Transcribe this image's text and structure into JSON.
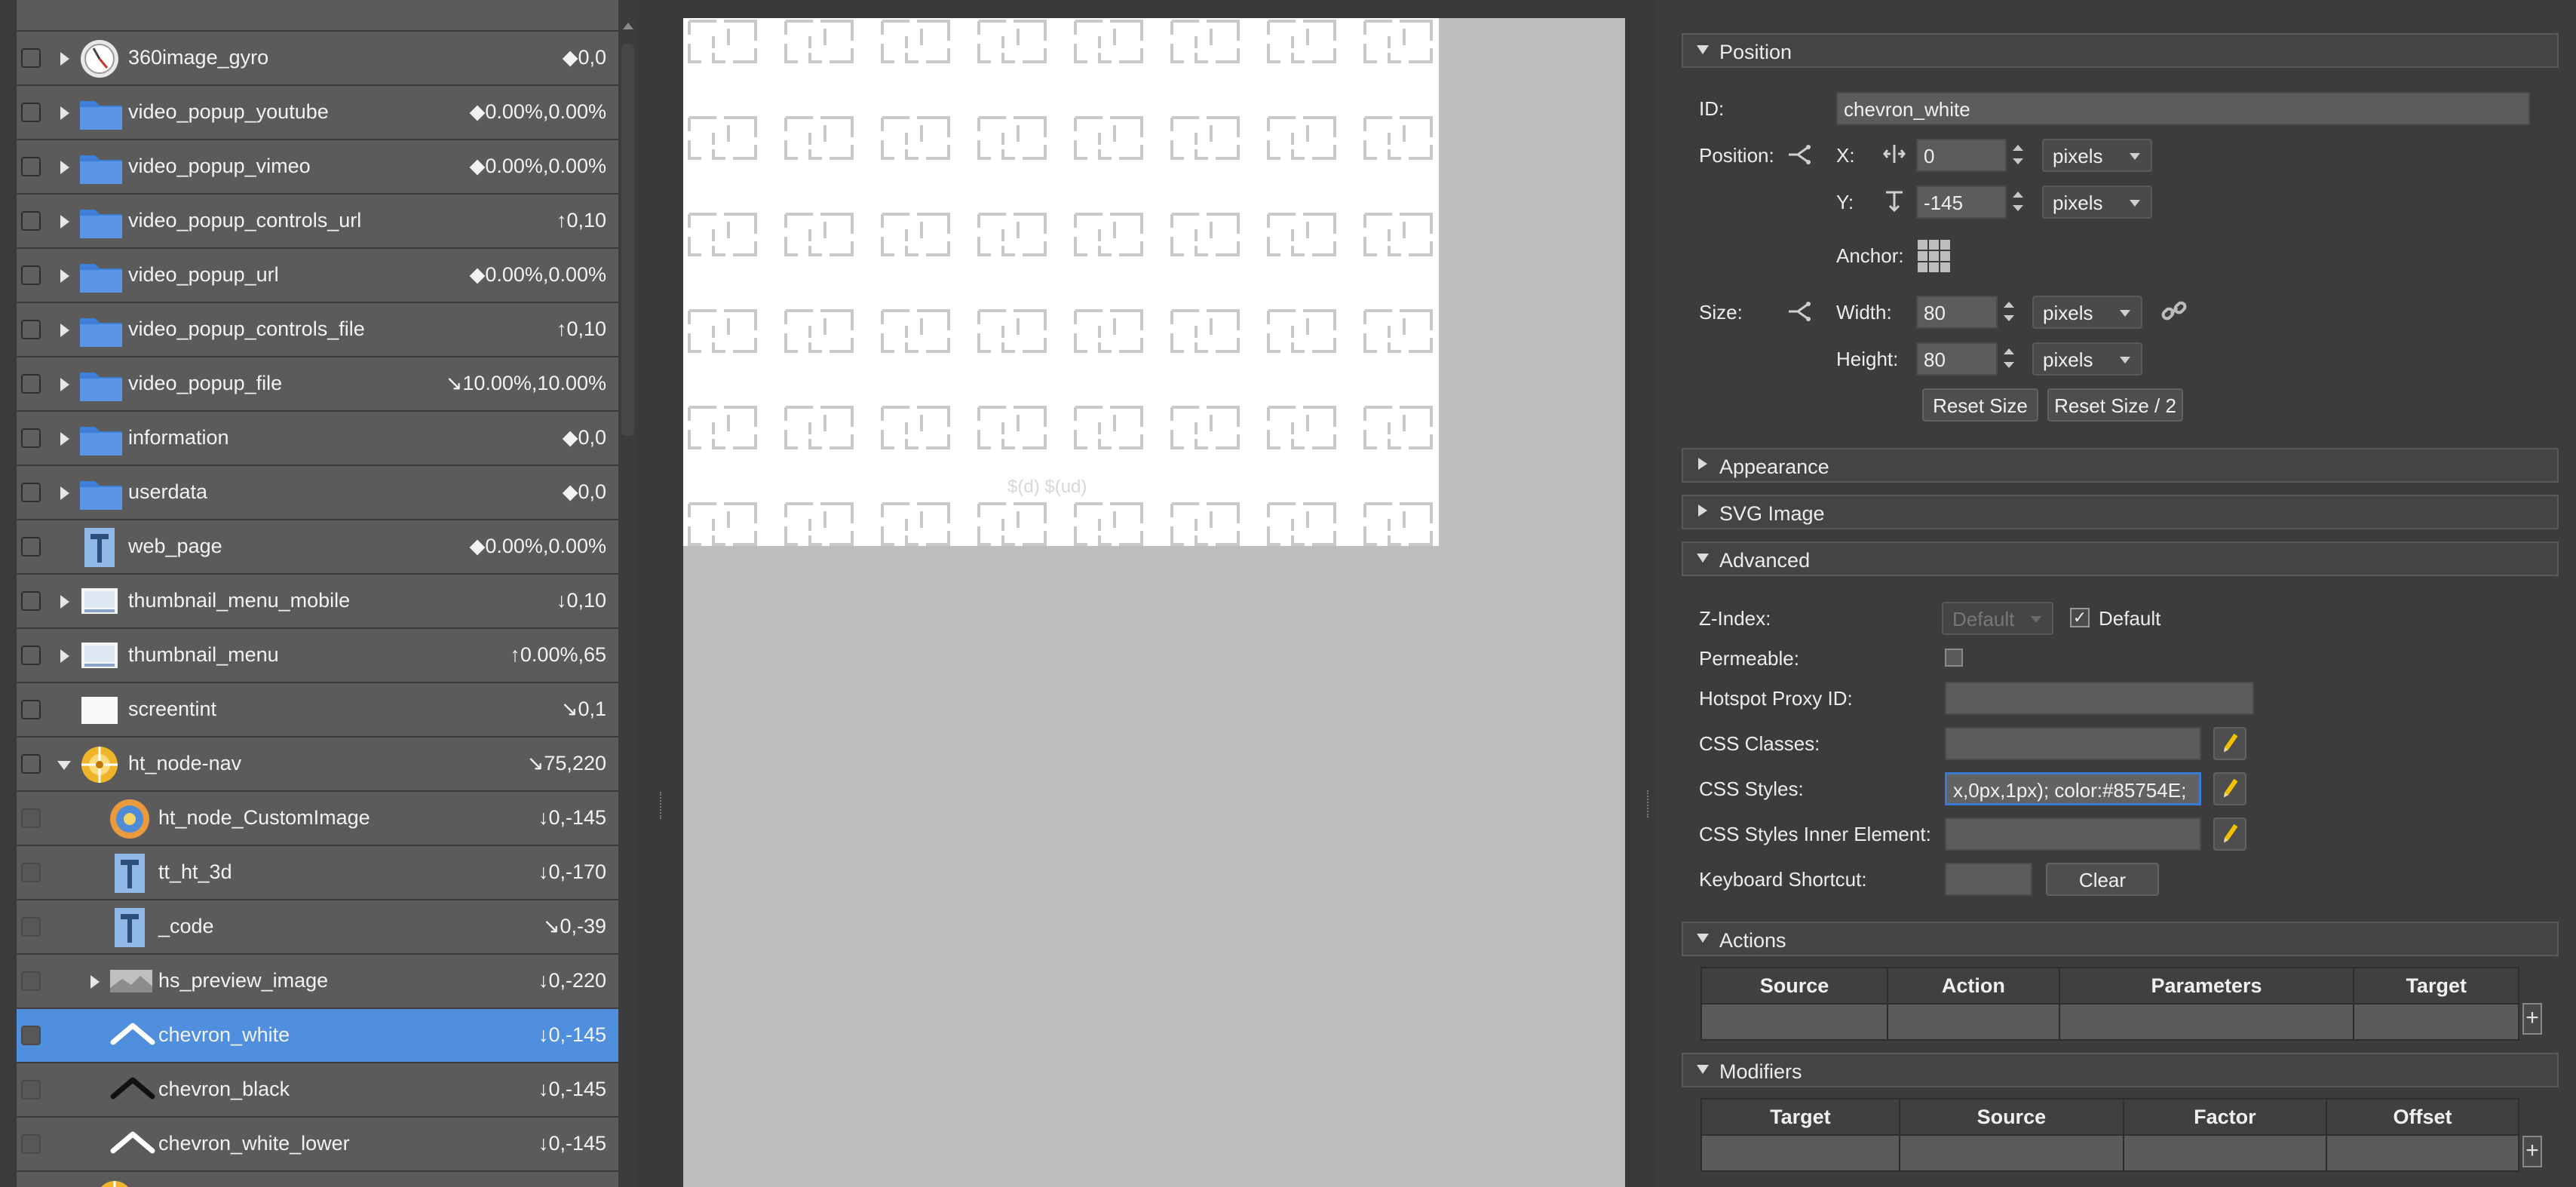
{
  "tree": {
    "rows": [
      {
        "label": "360image_gyro",
        "value": "◆0,0",
        "icon": "gyro-dial-icon",
        "expandable": true
      },
      {
        "label": "video_popup_youtube",
        "value": "◆0.00%,0.00%",
        "icon": "folder-icon",
        "expandable": true
      },
      {
        "label": "video_popup_vimeo",
        "value": "◆0.00%,0.00%",
        "icon": "folder-icon",
        "expandable": true
      },
      {
        "label": "video_popup_controls_url",
        "value": "↑0,10",
        "icon": "folder-icon",
        "expandable": true
      },
      {
        "label": "video_popup_url",
        "value": "◆0.00%,0.00%",
        "icon": "folder-icon",
        "expandable": true
      },
      {
        "label": "video_popup_controls_file",
        "value": "↑0,10",
        "icon": "folder-icon",
        "expandable": true
      },
      {
        "label": "video_popup_file",
        "value": "↘10.00%,10.00%",
        "icon": "folder-icon",
        "expandable": true
      },
      {
        "label": "information",
        "value": "◆0,0",
        "icon": "folder-icon",
        "expandable": true
      },
      {
        "label": "userdata",
        "value": "◆0,0",
        "icon": "folder-icon",
        "expandable": true
      },
      {
        "label": "web_page",
        "value": "◆0.00%,0.00%",
        "icon": "text-element-icon",
        "expandable": false
      },
      {
        "label": "thumbnail_menu_mobile",
        "value": "↓0,10",
        "icon": "thumbnail-icon",
        "expandable": true
      },
      {
        "label": "thumbnail_menu",
        "value": "↑0.00%,65",
        "icon": "thumbnail-icon",
        "expandable": true
      },
      {
        "label": "screentint",
        "value": "↘0,1",
        "icon": "rectangle-icon",
        "expandable": false
      },
      {
        "label": "ht_node-nav",
        "value": "↘75,220",
        "icon": "hotspot-node-icon",
        "expandable": true,
        "expanded": true
      },
      {
        "label": "ht_node_CustomImage",
        "value": "↓0,-145",
        "icon": "custom-image-icon",
        "expandable": false,
        "child": true
      },
      {
        "label": "tt_ht_3d",
        "value": "↓0,-170",
        "icon": "text-element-icon",
        "expandable": false,
        "child": true
      },
      {
        "label": "_code",
        "value": "↘0,-39",
        "icon": "text-element-icon",
        "expandable": false,
        "child": true
      },
      {
        "label": "hs_preview_image",
        "value": "↓0,-220",
        "icon": "preview-image-icon",
        "expandable": true,
        "child": true
      },
      {
        "label": "chevron_white",
        "value": "↓0,-145",
        "icon": "chevron-up-white-icon",
        "expandable": false,
        "child": true,
        "selected": true
      },
      {
        "label": "chevron_black",
        "value": "↓0,-145",
        "icon": "chevron-up-black-icon",
        "expandable": false,
        "child": true
      },
      {
        "label": "chevron_white_lower",
        "value": "↓0,-145",
        "icon": "chevron-up-white-icon",
        "expandable": false,
        "child": true
      }
    ]
  },
  "canvas": {
    "overlay_text": "$(d) $(ud)"
  },
  "props": {
    "position": {
      "section_title": "Position",
      "id_label": "ID:",
      "id_value": "chevron_white",
      "position_label": "Position:",
      "x_label": "X:",
      "x_value": "0",
      "x_unit": "pixels",
      "y_label": "Y:",
      "y_value": "-145",
      "y_unit": "pixels",
      "anchor_label": "Anchor:",
      "size_label": "Size:",
      "width_label": "Width:",
      "width_value": "80",
      "width_unit": "pixels",
      "height_label": "Height:",
      "height_value": "80",
      "height_unit": "pixels",
      "reset_size": "Reset Size",
      "reset_size_half": "Reset Size / 2"
    },
    "appearance_title": "Appearance",
    "svg_title": "SVG Image",
    "advanced": {
      "section_title": "Advanced",
      "zindex_label": "Z-Index:",
      "zindex_value": "Default",
      "zindex_default_label": "Default",
      "permeable_label": "Permeable:",
      "proxy_label": "Hotspot Proxy ID:",
      "css_classes_label": "CSS Classes:",
      "css_styles_label": "CSS Styles:",
      "css_styles_value": "x,0px,1px); color:#85754E;",
      "css_inner_label": "CSS Styles Inner Element:",
      "shortcut_label": "Keyboard Shortcut:",
      "clear_label": "Clear"
    },
    "actions": {
      "section_title": "Actions",
      "columns": [
        "Source",
        "Action",
        "Parameters",
        "Target"
      ]
    },
    "modifiers": {
      "section_title": "Modifiers",
      "columns": [
        "Target",
        "Source",
        "Factor",
        "Offset"
      ]
    }
  }
}
